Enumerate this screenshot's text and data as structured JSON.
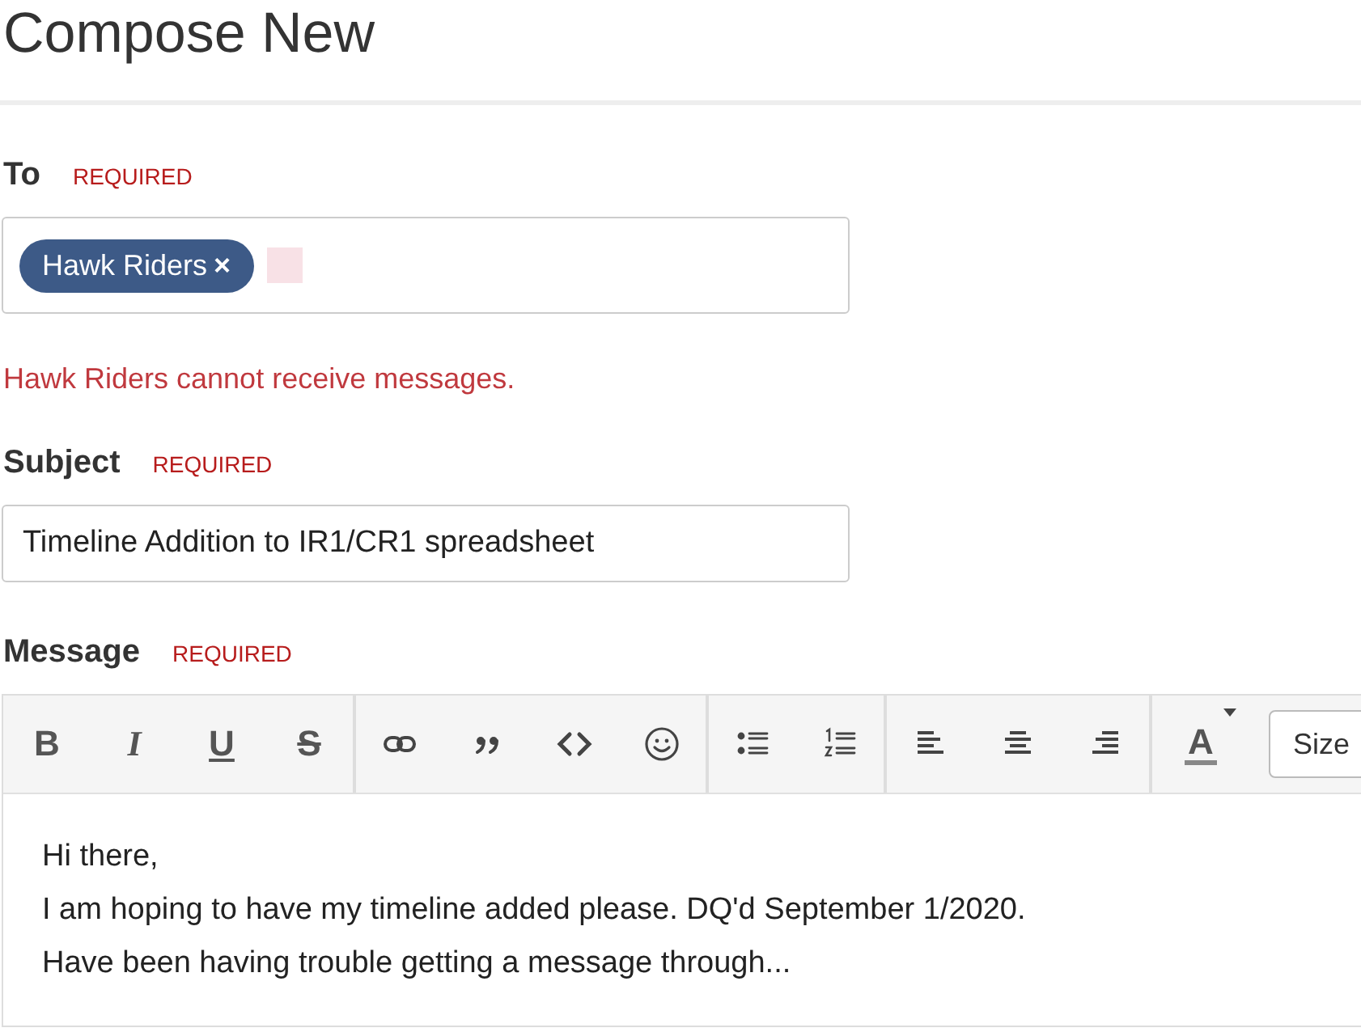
{
  "title": "Compose New",
  "to": {
    "label": "To",
    "required": "REQUIRED",
    "invalid": true,
    "recipients": [
      {
        "name": "Hawk Riders",
        "remove": "×"
      }
    ],
    "error": "Hawk Riders cannot receive messages."
  },
  "subject": {
    "label": "Subject",
    "required": "REQUIRED",
    "value": "Timeline Addition to IR1/CR1 spreadsheet"
  },
  "message": {
    "label": "Message",
    "required": "REQUIRED",
    "toolbar": [
      [
        {
          "kind": "bold",
          "label": "B"
        },
        {
          "kind": "italic",
          "label": "I"
        },
        {
          "kind": "underline",
          "label": "U"
        },
        {
          "kind": "strike",
          "label": "S"
        }
      ],
      [
        {
          "kind": "link"
        },
        {
          "kind": "quote"
        },
        {
          "kind": "code"
        },
        {
          "kind": "emoji"
        }
      ],
      [
        {
          "kind": "bullets"
        },
        {
          "kind": "numbers"
        }
      ],
      [
        {
          "kind": "alignleft"
        },
        {
          "kind": "aligncenter"
        },
        {
          "kind": "alignright"
        }
      ],
      [
        {
          "kind": "color",
          "label": "A"
        },
        {
          "kind": "size",
          "label": "Size"
        }
      ]
    ],
    "body": [
      "Hi there,",
      "I am hoping to have my timeline added please. DQ'd September 1/2020.",
      "Have been having trouble getting a message through..."
    ]
  }
}
